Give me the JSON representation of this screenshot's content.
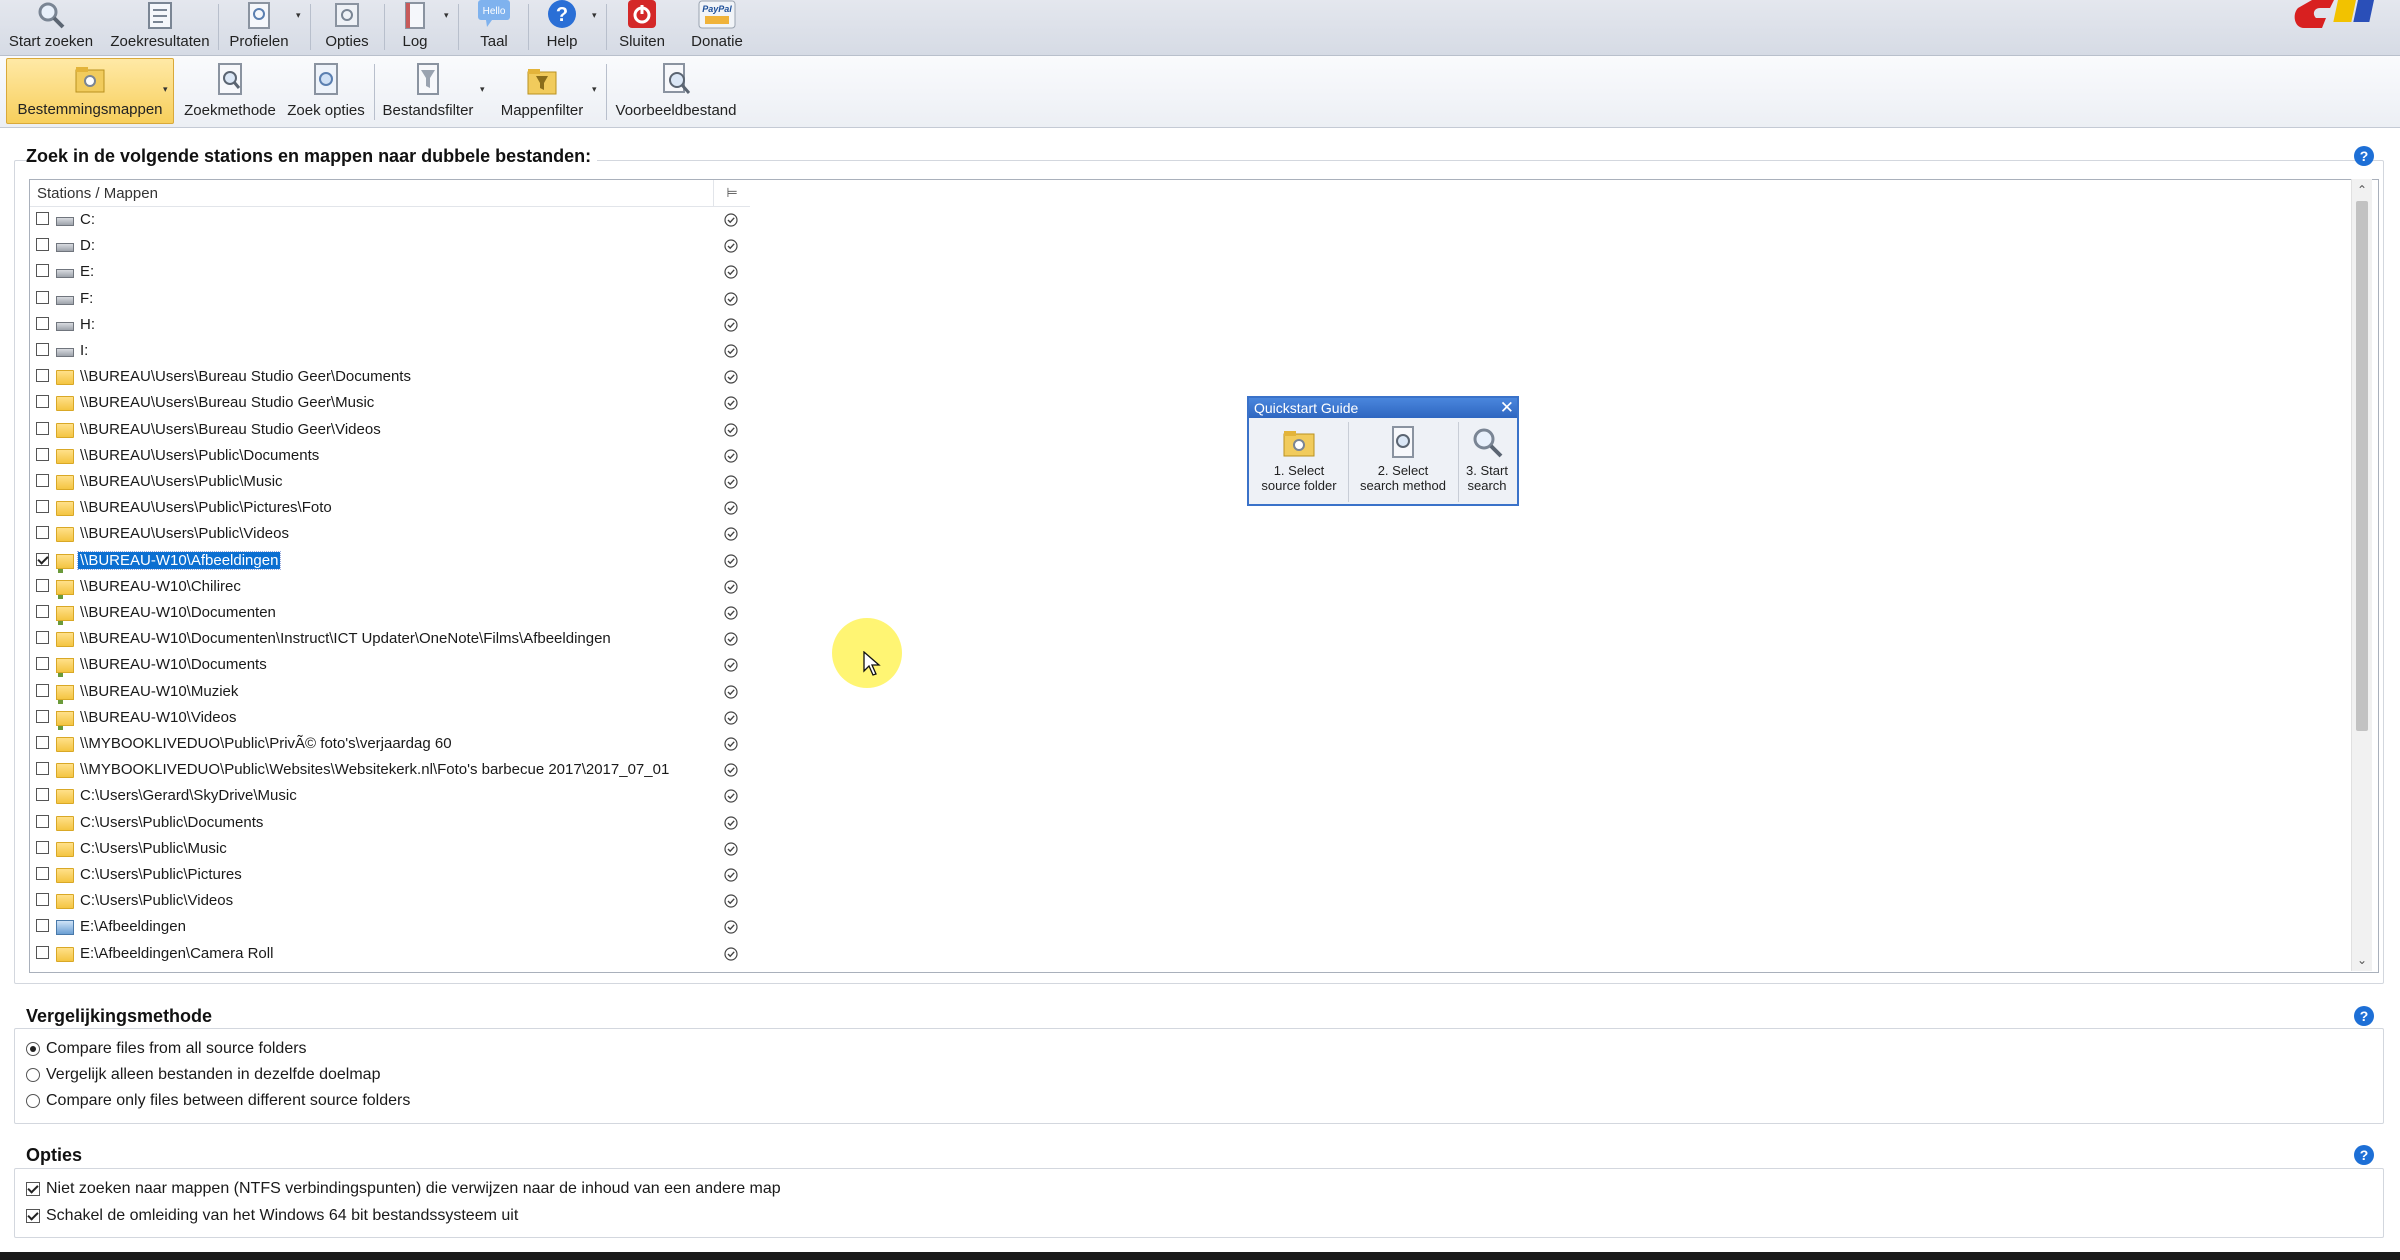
{
  "ribbon": {
    "top_buttons": [
      {
        "label": "Start zoeken",
        "icon": "magnifier-icon"
      },
      {
        "label": "Zoekresultaten",
        "icon": "results-icon"
      },
      {
        "label": "Profielen",
        "icon": "profile-icon"
      },
      {
        "label": "Opties",
        "icon": "options-icon"
      },
      {
        "label": "Log",
        "icon": "log-icon"
      },
      {
        "label": "Taal",
        "icon": "language-icon",
        "badge": "Hello"
      },
      {
        "label": "Help",
        "icon": "help-icon"
      },
      {
        "label": "Sluiten",
        "icon": "power-icon"
      },
      {
        "label": "Donatie",
        "icon": "paypal-icon",
        "badge": "PayPal"
      }
    ],
    "sub_buttons": [
      {
        "label": "Bestemmingsmappen",
        "icon": "folder-search-icon",
        "active": true
      },
      {
        "label": "Zoekmethode",
        "icon": "search-method-icon"
      },
      {
        "label": "Zoek opties",
        "icon": "search-options-icon"
      },
      {
        "label": "Bestandsfilter",
        "icon": "file-filter-icon"
      },
      {
        "label": "Mappenfilter",
        "icon": "folder-filter-icon"
      },
      {
        "label": "Voorbeeldbestand",
        "icon": "sample-file-icon"
      }
    ]
  },
  "folders_section": {
    "title": "Zoek in de volgende stations en mappen naar dubbele bestanden:",
    "column_header": "Stations / Mappen",
    "rows": [
      {
        "text": "C:",
        "icon": "drive",
        "checked": false,
        "selected": false
      },
      {
        "text": "D:",
        "icon": "drive",
        "checked": false,
        "selected": false
      },
      {
        "text": "E:",
        "icon": "drive",
        "checked": false,
        "selected": false
      },
      {
        "text": "F:",
        "icon": "drive",
        "checked": false,
        "selected": false
      },
      {
        "text": "H:",
        "icon": "drive",
        "checked": false,
        "selected": false
      },
      {
        "text": "I:",
        "icon": "drive",
        "checked": false,
        "selected": false
      },
      {
        "text": "\\\\BUREAU\\Users\\Bureau Studio Geer\\Documents",
        "icon": "folder",
        "checked": false,
        "selected": false
      },
      {
        "text": "\\\\BUREAU\\Users\\Bureau Studio Geer\\Music",
        "icon": "folder",
        "checked": false,
        "selected": false
      },
      {
        "text": "\\\\BUREAU\\Users\\Bureau Studio Geer\\Videos",
        "icon": "folder",
        "checked": false,
        "selected": false
      },
      {
        "text": "\\\\BUREAU\\Users\\Public\\Documents",
        "icon": "folder",
        "checked": false,
        "selected": false
      },
      {
        "text": "\\\\BUREAU\\Users\\Public\\Music",
        "icon": "folder",
        "checked": false,
        "selected": false
      },
      {
        "text": "\\\\BUREAU\\Users\\Public\\Pictures\\Foto",
        "icon": "folder",
        "checked": false,
        "selected": false
      },
      {
        "text": "\\\\BUREAU\\Users\\Public\\Videos",
        "icon": "folder",
        "checked": false,
        "selected": false
      },
      {
        "text": "\\\\BUREAU-W10\\Afbeeldingen",
        "icon": "netfolder",
        "checked": true,
        "selected": true
      },
      {
        "text": "\\\\BUREAU-W10\\Chilirec",
        "icon": "netfolder",
        "checked": false,
        "selected": false
      },
      {
        "text": "\\\\BUREAU-W10\\Documenten",
        "icon": "netfolder",
        "checked": false,
        "selected": false
      },
      {
        "text": "\\\\BUREAU-W10\\Documenten\\Instruct\\ICT Updater\\OneNote\\Films\\Afbeeldingen",
        "icon": "folder",
        "checked": false,
        "selected": false
      },
      {
        "text": "\\\\BUREAU-W10\\Documents",
        "icon": "netfolder",
        "checked": false,
        "selected": false
      },
      {
        "text": "\\\\BUREAU-W10\\Muziek",
        "icon": "netfolder",
        "checked": false,
        "selected": false
      },
      {
        "text": "\\\\BUREAU-W10\\Videos",
        "icon": "netfolder",
        "checked": false,
        "selected": false
      },
      {
        "text": "\\\\MYBOOKLIVEDUO\\Public\\PrivÃ© foto's\\verjaardag 60",
        "icon": "folder",
        "checked": false,
        "selected": false
      },
      {
        "text": "\\\\MYBOOKLIVEDUO\\Public\\Websites\\Websitekerk.nl\\Foto's barbecue 2017\\2017_07_01",
        "icon": "folder",
        "checked": false,
        "selected": false
      },
      {
        "text": "C:\\Users\\Gerard\\SkyDrive\\Music",
        "icon": "folder",
        "checked": false,
        "selected": false
      },
      {
        "text": "C:\\Users\\Public\\Documents",
        "icon": "folder",
        "checked": false,
        "selected": false
      },
      {
        "text": "C:\\Users\\Public\\Music",
        "icon": "folder",
        "checked": false,
        "selected": false
      },
      {
        "text": "C:\\Users\\Public\\Pictures",
        "icon": "folder",
        "checked": false,
        "selected": false
      },
      {
        "text": "C:\\Users\\Public\\Videos",
        "icon": "folder",
        "checked": false,
        "selected": false
      },
      {
        "text": "E:\\Afbeeldingen",
        "icon": "picfolder",
        "checked": false,
        "selected": false
      },
      {
        "text": "E:\\Afbeeldingen\\Camera Roll",
        "icon": "folder",
        "checked": false,
        "selected": false
      }
    ]
  },
  "quickstart": {
    "title": "Quickstart Guide",
    "steps": [
      {
        "line1": "1. Select",
        "line2": "source folder"
      },
      {
        "line1": "2. Select",
        "line2": "search method"
      },
      {
        "line1": "3. Start",
        "line2": "search"
      }
    ]
  },
  "compare_section": {
    "title": "Vergelijkingsmethode",
    "options": [
      {
        "label": "Compare files from all source folders",
        "selected": true
      },
      {
        "label": "Vergelijk alleen bestanden in dezelfde doelmap",
        "selected": false
      },
      {
        "label": "Compare only files between different source folders",
        "selected": false
      }
    ]
  },
  "options_section": {
    "title": "Opties",
    "options": [
      {
        "label": "Niet zoeken naar mappen (NTFS verbindingspunten) die verwijzen naar de inhoud van een andere map",
        "checked": true
      },
      {
        "label": "Schakel de omleiding van het Windows 64 bit bestandssysteem uit",
        "checked": true
      }
    ]
  },
  "help_glyph": "?",
  "colors": {
    "selection": "#0c6fd1",
    "active_button": "#f7cf5c",
    "help": "#1d6fd6"
  }
}
